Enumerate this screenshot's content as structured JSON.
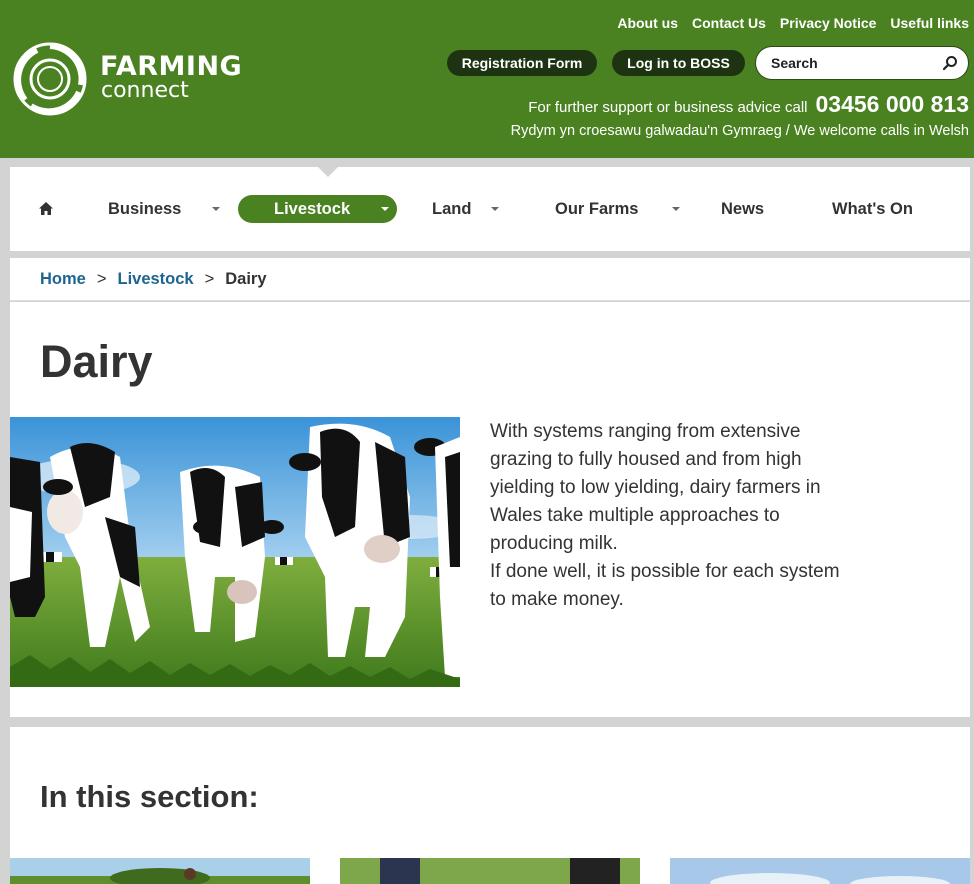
{
  "header": {
    "logo": {
      "line1": "FARMING",
      "line2": "connect"
    },
    "top_links": [
      "About us",
      "Contact Us",
      "Privacy Notice",
      "Useful links"
    ],
    "registration_label": "Registration Form",
    "boss_label": "Log in to BOSS",
    "search": {
      "placeholder": "Search",
      "value": ""
    },
    "support_text": "For further support or business advice call",
    "phone": "03456 000 813",
    "welsh_text": "Rydym yn croesawu galwadau'n Gymraeg / We welcome calls in Welsh"
  },
  "nav": {
    "items": [
      {
        "label": "Business",
        "dropdown": true
      },
      {
        "label": "Livestock",
        "dropdown": true,
        "active": true
      },
      {
        "label": "Land",
        "dropdown": true
      },
      {
        "label": "Our Farms",
        "dropdown": true
      },
      {
        "label": "News",
        "dropdown": false
      },
      {
        "label": "What's On",
        "dropdown": false
      }
    ]
  },
  "breadcrumb": {
    "home": "Home",
    "parent": "Livestock",
    "current": "Dairy",
    "separator": ">"
  },
  "page": {
    "title": "Dairy",
    "paragraph1": "With systems ranging from extensive grazing to fully housed and from high yielding to low yielding, dairy farmers in Wales take multiple approaches to producing milk.",
    "paragraph2": "If done well, it is possible for each system to make money."
  },
  "section": {
    "title": "In this section:"
  },
  "colors": {
    "brand_green": "#4a8222",
    "dark_button": "#1e3312",
    "link_blue": "#1d6591",
    "page_bg": "#d3d3d3"
  },
  "icons": [
    "home-icon",
    "search-icon",
    "chevron-down-icon"
  ]
}
